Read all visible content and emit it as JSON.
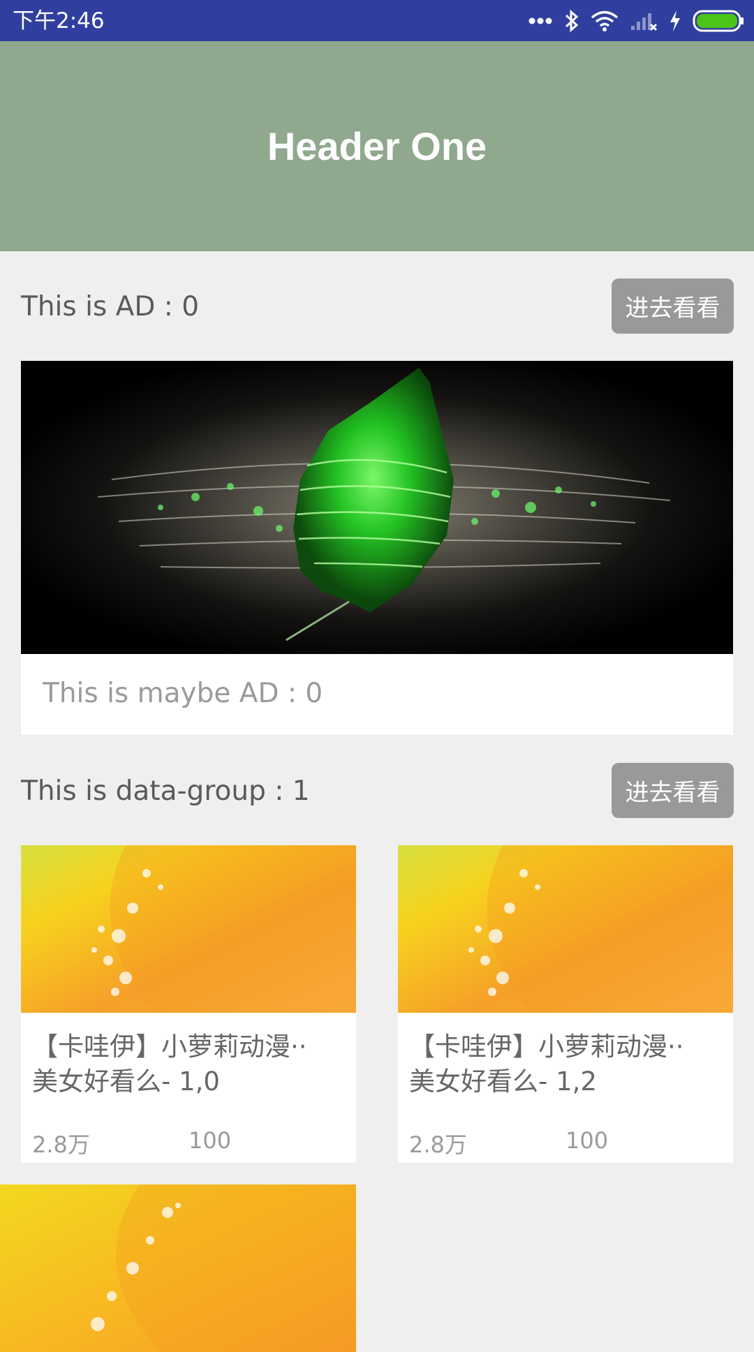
{
  "status_bar": {
    "time": "下午2:46",
    "icons": [
      "more-dots-icon",
      "bluetooth-icon",
      "wifi-icon",
      "signal-icon",
      "charging-icon",
      "battery-icon"
    ],
    "color": "#303f9f"
  },
  "header": {
    "title": "Header One",
    "background": "#90a88e"
  },
  "ad_section": {
    "title": "This is AD : 0",
    "button_label": "进去看看",
    "caption": "This is maybe AD : 0"
  },
  "data_group": {
    "title": "This is data-group : 1",
    "button_label": "进去看看",
    "items": [
      {
        "title_line1": "【卡哇伊】小萝莉动漫··",
        "title_line2": "美女好看么- 1,0",
        "views": "2.8万",
        "count": "100"
      },
      {
        "title_line1": "【卡哇伊】小萝莉动漫··",
        "title_line2": "美女好看么- 1,2",
        "views": "2.8万",
        "count": "100"
      }
    ]
  }
}
